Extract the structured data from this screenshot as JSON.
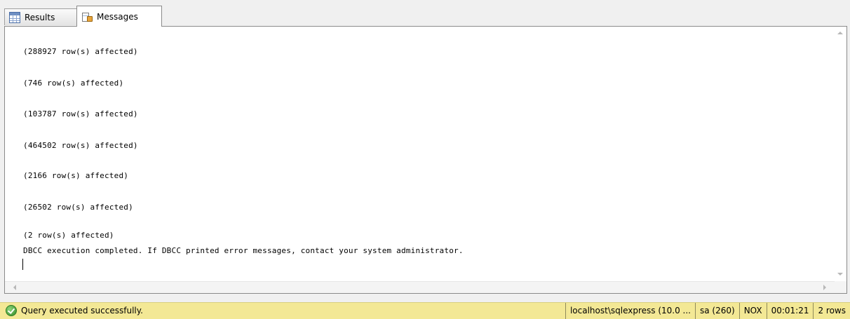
{
  "tabs": [
    {
      "label": "Results",
      "icon": "grid-icon",
      "active": false
    },
    {
      "label": "Messages",
      "icon": "messages-icon",
      "active": true
    }
  ],
  "messages": {
    "lines": [
      "(288927 row(s) affected)",
      "(746 row(s) affected)",
      "(103787 row(s) affected)",
      "(464502 row(s) affected)",
      "(2166 row(s) affected)",
      "(26502 row(s) affected)",
      "(2 row(s) affected)",
      "DBCC execution completed. If DBCC printed error messages, contact your system administrator."
    ]
  },
  "status": {
    "message": "Query executed successfully.",
    "icon": "success-check-icon",
    "server": "localhost\\sqlexpress (10.0 ...",
    "login": "sa (260)",
    "database": "NOX",
    "elapsed": "00:01:21",
    "rows": "2 rows",
    "background_color": "#f3e895"
  }
}
